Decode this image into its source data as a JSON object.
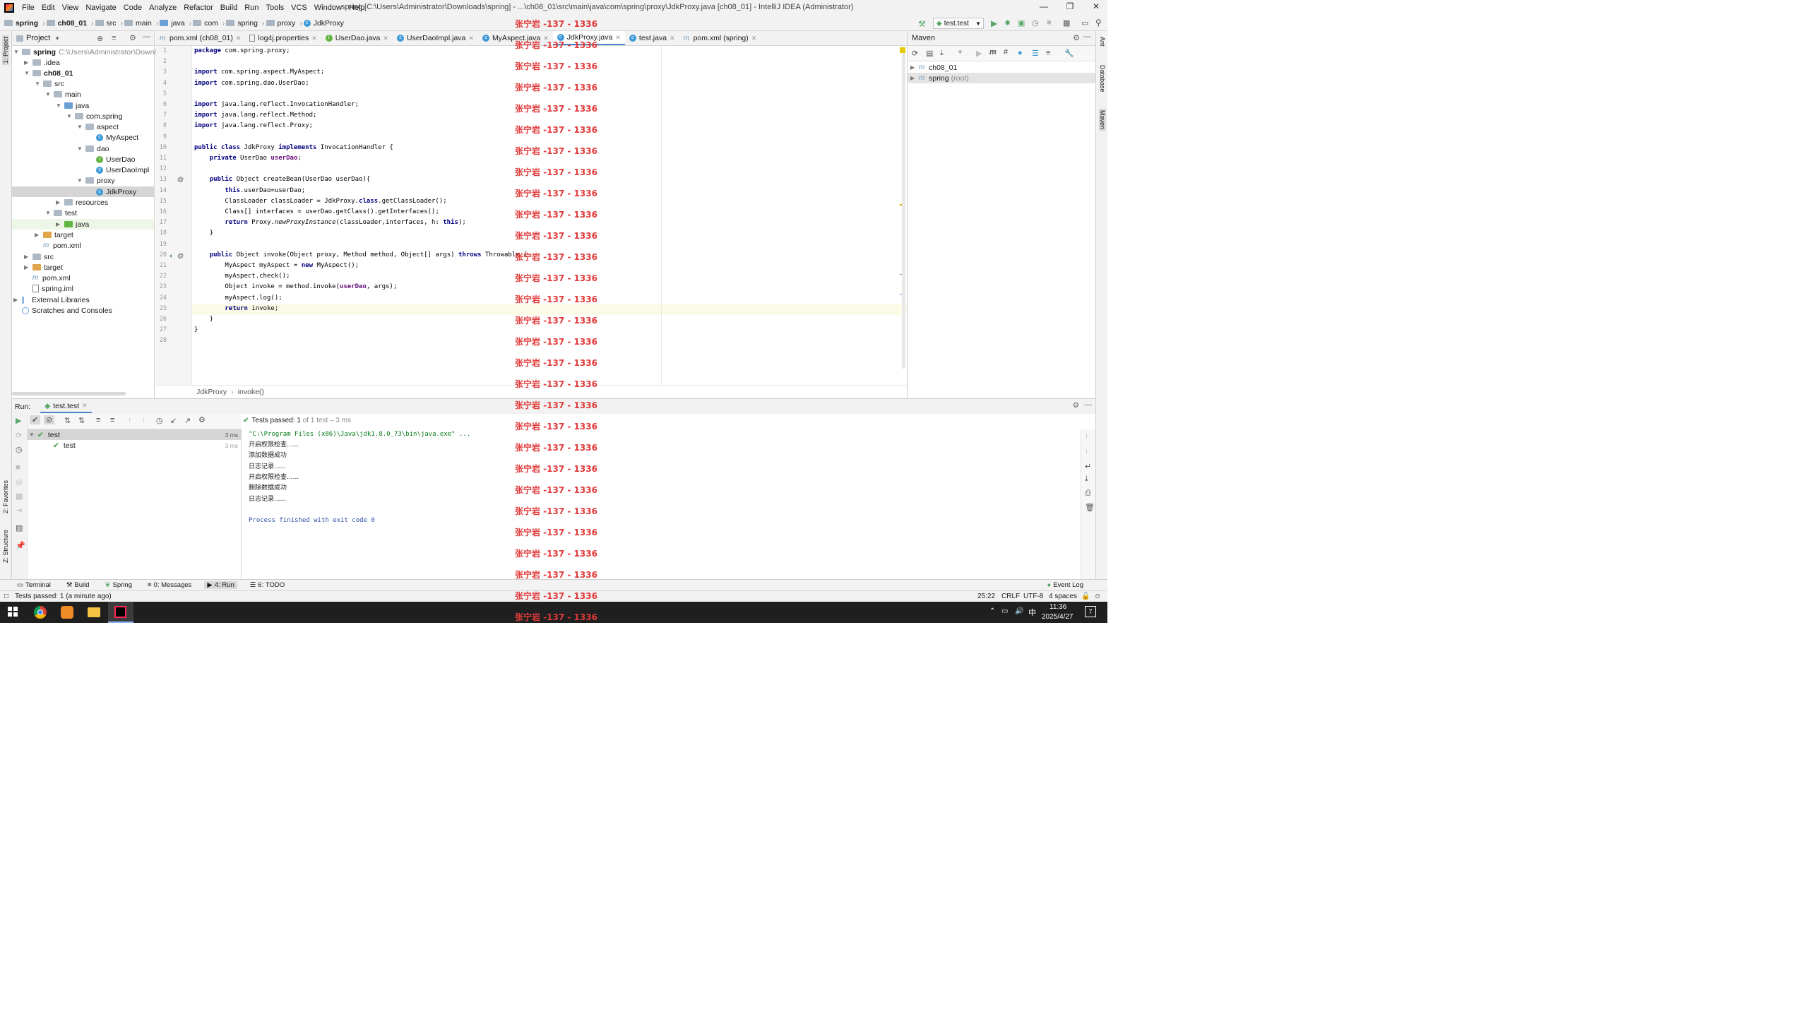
{
  "menu": [
    "File",
    "Edit",
    "View",
    "Navigate",
    "Code",
    "Analyze",
    "Refactor",
    "Build",
    "Run",
    "Tools",
    "VCS",
    "Window",
    "Help"
  ],
  "window_title": "spring [C:\\Users\\Administrator\\Downloads\\spring] - ...\\ch08_01\\src\\main\\java\\com\\spring\\proxy\\JdkProxy.java [ch08_01] - IntelliJ IDEA (Administrator)",
  "breadcrumb": [
    "spring",
    "ch08_01",
    "src",
    "main",
    "java",
    "com",
    "spring",
    "proxy",
    "JdkProxy"
  ],
  "run_config": "test.test",
  "left_stripe": {
    "project": "1: Project",
    "favorites": "2: Favorites",
    "structure": "Z: Structure"
  },
  "right_stripe": {
    "ant": "Ant",
    "database": "Database",
    "maven": "Maven"
  },
  "project_panel": {
    "title": "Project",
    "tree": [
      {
        "label": "spring",
        "path": "C:\\Users\\Administrator\\Downlo",
        "icon": "folder"
      },
      {
        "label": ".idea",
        "icon": "folder"
      },
      {
        "label": "ch08_01",
        "icon": "folder"
      },
      {
        "label": "src",
        "icon": "folder"
      },
      {
        "label": "main",
        "icon": "folder"
      },
      {
        "label": "java",
        "icon": "folder-blue"
      },
      {
        "label": "com.spring",
        "icon": "folder"
      },
      {
        "label": "aspect",
        "icon": "folder"
      },
      {
        "label": "MyAspect",
        "icon": "class"
      },
      {
        "label": "dao",
        "icon": "folder"
      },
      {
        "label": "UserDao",
        "icon": "interface"
      },
      {
        "label": "UserDaoImpl",
        "icon": "class"
      },
      {
        "label": "proxy",
        "icon": "folder"
      },
      {
        "label": "JdkProxy",
        "icon": "class"
      },
      {
        "label": "resources",
        "icon": "folder"
      },
      {
        "label": "test",
        "icon": "folder"
      },
      {
        "label": "java",
        "icon": "folder-green"
      },
      {
        "label": "target",
        "icon": "folder-orange"
      },
      {
        "label": "pom.xml",
        "icon": "maven"
      },
      {
        "label": "src",
        "icon": "folder"
      },
      {
        "label": "target",
        "icon": "folder-orange"
      },
      {
        "label": "pom.xml",
        "icon": "maven"
      },
      {
        "label": "spring.iml",
        "icon": "file"
      },
      {
        "label": "External Libraries",
        "icon": "library"
      },
      {
        "label": "Scratches and Consoles",
        "icon": "scratch"
      }
    ]
  },
  "tabs": [
    {
      "label": "pom.xml (ch08_01)",
      "icon": "m"
    },
    {
      "label": "log4j.properties",
      "icon": "file"
    },
    {
      "label": "UserDao.java",
      "icon": "i"
    },
    {
      "label": "UserDaoImpl.java",
      "icon": "c"
    },
    {
      "label": "MyAspect.java",
      "icon": "c"
    },
    {
      "label": "JdkProxy.java",
      "icon": "c"
    },
    {
      "label": "test.java",
      "icon": "c"
    },
    {
      "label": "pom.xml (spring)",
      "icon": "m"
    }
  ],
  "code": [
    "package com.spring.proxy;",
    "",
    "import com.spring.aspect.MyAspect;",
    "import com.spring.dao.UserDao;",
    "",
    "import java.lang.reflect.InvocationHandler;",
    "import java.lang.reflect.Method;",
    "import java.lang.reflect.Proxy;",
    "",
    "public class JdkProxy implements InvocationHandler {",
    "    private UserDao userDao;",
    "",
    "    public Object createBean(UserDao userDao){",
    "        this.userDao=userDao;",
    "        ClassLoader classLoader = JdkProxy.class.getClassLoader();",
    "        Class[] interfaces = userDao.getClass().getInterfaces();",
    "        return Proxy.newProxyInstance(classLoader,interfaces, h: this);",
    "    }",
    "",
    "    public Object invoke(Object proxy, Method method, Object[] args) throws Throwable {",
    "        MyAspect myAspect = new MyAspect();",
    "        myAspect.check();",
    "        Object invoke = method.invoke(userDao, args);",
    "        myAspect.log();",
    "        return invoke;",
    "    }",
    "}",
    ""
  ],
  "editor_breadcrumb": [
    "JdkProxy",
    "invoke()"
  ],
  "maven": {
    "title": "Maven",
    "items": [
      {
        "label": "ch08_01",
        "suffix": ""
      },
      {
        "label": "spring",
        "suffix": "(root)"
      }
    ]
  },
  "run": {
    "label": "Run:",
    "tab": "test.test",
    "tests_passed": "Tests passed:",
    "tests_count": "1",
    "tests_detail": "of 1 test – 3 ms",
    "tree": [
      {
        "label": "test",
        "time": "3 ms"
      },
      {
        "label": "test",
        "time": "3 ms"
      }
    ],
    "console": [
      "\"C:\\Program Files (x86)\\Java\\jdk1.8.0_73\\bin\\java.exe\" ...",
      "开启权限检查......",
      "添加数据成功",
      "日志记录......",
      "开启权限检查......",
      "删除数据成功",
      "日志记录......",
      "",
      "Process finished with exit code 0"
    ]
  },
  "toolwindows": [
    {
      "label": "Terminal",
      "num": ""
    },
    {
      "label": "Build",
      "num": ""
    },
    {
      "label": "Spring",
      "num": ""
    },
    {
      "label": "Messages",
      "num": "0:"
    },
    {
      "label": "Run",
      "num": "4:"
    },
    {
      "label": "TODO",
      "num": "6:"
    }
  ],
  "event_log": "Event Log",
  "status": {
    "message": "Tests passed: 1 (a minute ago)",
    "position": "25:22",
    "line_sep": "CRLF",
    "encoding": "UTF-8",
    "indent": "4 spaces"
  },
  "taskbar": {
    "time": "11:36",
    "date": "2025/4/27",
    "ime": "中",
    "notif": "7"
  },
  "watermark": "张宁岩 -137 - 1336",
  "colors": {
    "keyword": "#000080",
    "field": "#660e7a",
    "string": "#067d17",
    "accent": "#4a86c8",
    "pass": "#59a869",
    "watermark": "#e23a3a"
  }
}
